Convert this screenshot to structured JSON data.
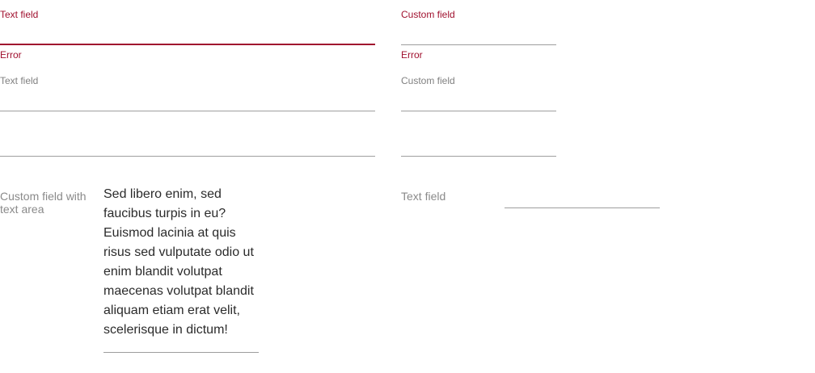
{
  "row1": {
    "left": {
      "label": "Text field",
      "error": "Error"
    },
    "right": {
      "label": "Custom field",
      "error": "Error"
    }
  },
  "row2": {
    "left": {
      "label": "Text field"
    },
    "right": {
      "label": "Custom field"
    }
  },
  "row4": {
    "left": {
      "label": "Custom field with text area",
      "value": "Sed libero enim, sed faucibus turpis in eu? Euismod lacinia at quis risus sed vulputate odio ut enim blandit volutpat maecenas volutpat blandit aliquam etiam erat velit, scelerisque in dictum!"
    },
    "right": {
      "label": "Text field"
    }
  },
  "colors": {
    "error": "#a0102e",
    "label": "#808080",
    "underline": "#9e9e9e",
    "text": "#2b2b2b"
  }
}
